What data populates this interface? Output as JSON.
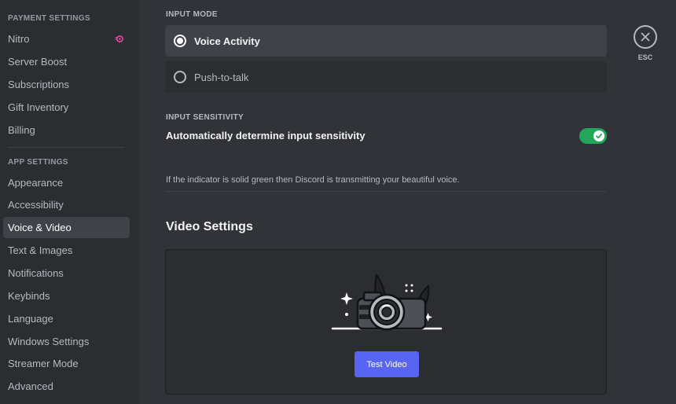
{
  "sidebar": {
    "payment_header": "PAYMENT SETTINGS",
    "payment_items": [
      {
        "label": "Nitro",
        "icon": "nitro-icon"
      },
      {
        "label": "Server Boost"
      },
      {
        "label": "Subscriptions"
      },
      {
        "label": "Gift Inventory"
      },
      {
        "label": "Billing"
      }
    ],
    "app_header": "APP SETTINGS",
    "app_items": [
      {
        "label": "Appearance"
      },
      {
        "label": "Accessibility"
      },
      {
        "label": "Voice & Video",
        "active": true
      },
      {
        "label": "Text & Images"
      },
      {
        "label": "Notifications"
      },
      {
        "label": "Keybinds"
      },
      {
        "label": "Language"
      },
      {
        "label": "Windows Settings"
      },
      {
        "label": "Streamer Mode"
      },
      {
        "label": "Advanced"
      }
    ]
  },
  "input_mode": {
    "header": "INPUT MODE",
    "options": [
      {
        "label": "Voice Activity",
        "selected": true
      },
      {
        "label": "Push-to-talk",
        "selected": false
      }
    ]
  },
  "input_sensitivity": {
    "header": "INPUT SENSITIVITY",
    "auto_label": "Automatically determine input sensitivity",
    "auto_enabled": true,
    "hint": "If the indicator is solid green then Discord is transmitting your beautiful voice."
  },
  "video": {
    "title": "Video Settings",
    "test_button": "Test Video"
  },
  "close": {
    "label": "ESC",
    "icon": "close-icon"
  },
  "colors": {
    "accent": "#5865f2",
    "toggle_on": "#23a55a",
    "nitro": "#eb459f",
    "background": "#313338",
    "sidebar": "#2b2d31"
  }
}
